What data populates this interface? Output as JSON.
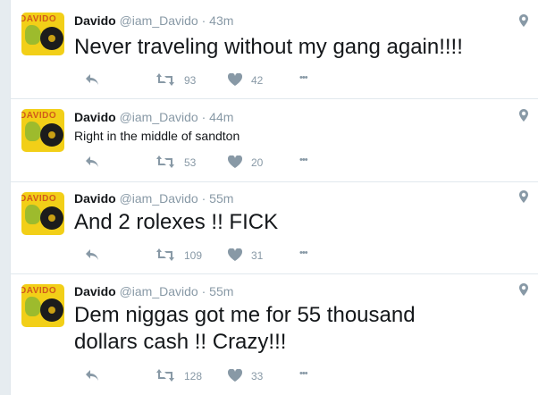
{
  "tweets": [
    {
      "name": "Davido",
      "handle": "@iam_Davido",
      "dot": "·",
      "time": "43m",
      "avatar_text": "DAVIDO",
      "text": "Never traveling without my gang again!!!!",
      "retweets": "93",
      "likes": "42",
      "more": "•••"
    },
    {
      "name": "Davido",
      "handle": "@iam_Davido",
      "dot": "·",
      "time": "44m",
      "avatar_text": "DAVIDO",
      "text": "Right in the middle of sandton",
      "retweets": "53",
      "likes": "20",
      "more": "•••"
    },
    {
      "name": "Davido",
      "handle": "@iam_Davido",
      "dot": "·",
      "time": "55m",
      "avatar_text": "DAVIDO",
      "text": "And 2 rolexes !! FICK",
      "retweets": "109",
      "likes": "31",
      "more": "•••"
    },
    {
      "name": "Davido",
      "handle": "@iam_Davido",
      "dot": "·",
      "time": "55m",
      "avatar_text": "DAVIDO",
      "text_line1": "Dem niggas got me for 55 thousand",
      "text_line2": "dollars cash !! Crazy!!!",
      "retweets": "128",
      "likes": "33",
      "more": "•••"
    }
  ],
  "icons": {
    "reply": "reply-icon",
    "retweet": "retweet-icon",
    "like": "heart-icon",
    "more": "more-icon",
    "location": "location-pin-icon"
  },
  "colors": {
    "icon_gray": "#8899a6",
    "text": "#14171a",
    "border": "#e1e8ed",
    "avatar_bg": "#f2cf18"
  }
}
